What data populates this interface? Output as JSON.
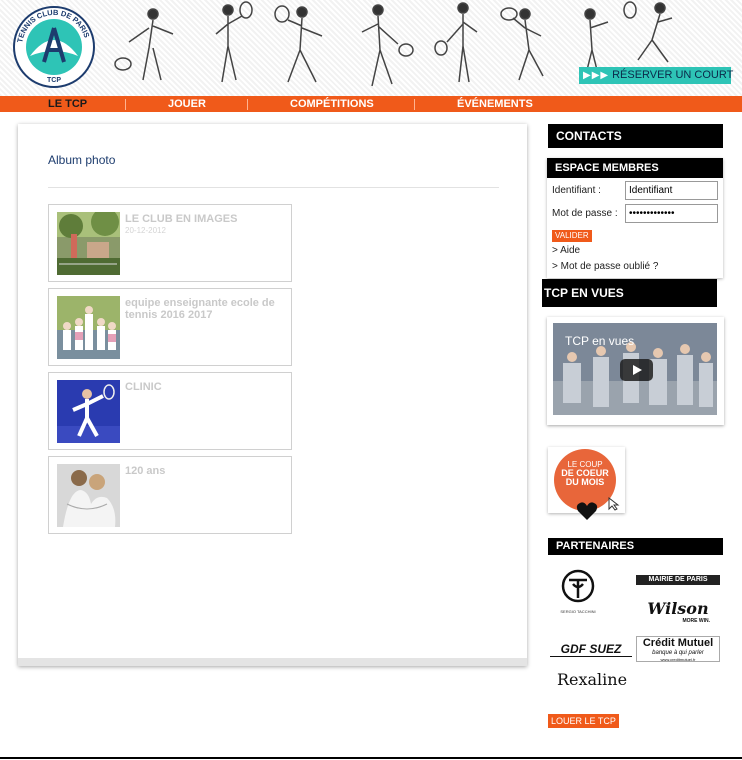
{
  "header": {
    "logo_text_arc": "TENNIS CLUB DE PARIS",
    "logo_text_bottom": "TCP",
    "reserve_arrows": "▶▶▶",
    "reserve_label": "RÉSERVER UN COURT"
  },
  "nav": {
    "items": [
      {
        "label": "LE TCP",
        "active": true
      },
      {
        "label": "JOUER"
      },
      {
        "label": "COMPÉTITIONS"
      },
      {
        "label": "ÉVÉNEMENTS"
      }
    ]
  },
  "main": {
    "title": "Album photo",
    "albums": [
      {
        "name": "LE CLUB EN IMAGES",
        "date": "20-12-2012"
      },
      {
        "name": "equipe enseignante ecole de tennis 2016 2017",
        "date": ""
      },
      {
        "name": "CLINIC",
        "date": ""
      },
      {
        "name": "120 ans",
        "date": ""
      }
    ]
  },
  "sidebar": {
    "contacts": "CONTACTS",
    "members": {
      "title": "ESPACE MEMBRES",
      "id_label": "Identifiant :",
      "id_value": "Identifiant",
      "pw_label": "Mot de passe :",
      "pw_value": "•••••••••••••",
      "submit": "VALIDER",
      "help": "> Aide",
      "forgot": "> Mot de passe oublié ?"
    },
    "tcp_en_vues": "TCP EN VUES",
    "video_title": "TCP en vues",
    "coeur": {
      "line1": "LE COUP",
      "line2": "DE COEUR",
      "line3": "DU MOIS"
    },
    "partners_title": "PARTENAIRES",
    "partners": {
      "tacchini": "SERGIO TACCHINI",
      "mairie": "MAIRIE DE PARIS",
      "wilson": "Wilson",
      "wilson_tag": "MORE WIN.",
      "gdf": "GDF SUEZ",
      "credit": "Crédit Mutuel",
      "credit_tag": "banque à qui parler",
      "credit_url": "www.creditmutuel.fr",
      "rexaline": "Rexaline"
    },
    "louer": "LOUER LE TCP"
  },
  "colors": {
    "accent": "#f05a1a",
    "teal": "#2ec4b6",
    "navy": "#1d3c6e"
  }
}
